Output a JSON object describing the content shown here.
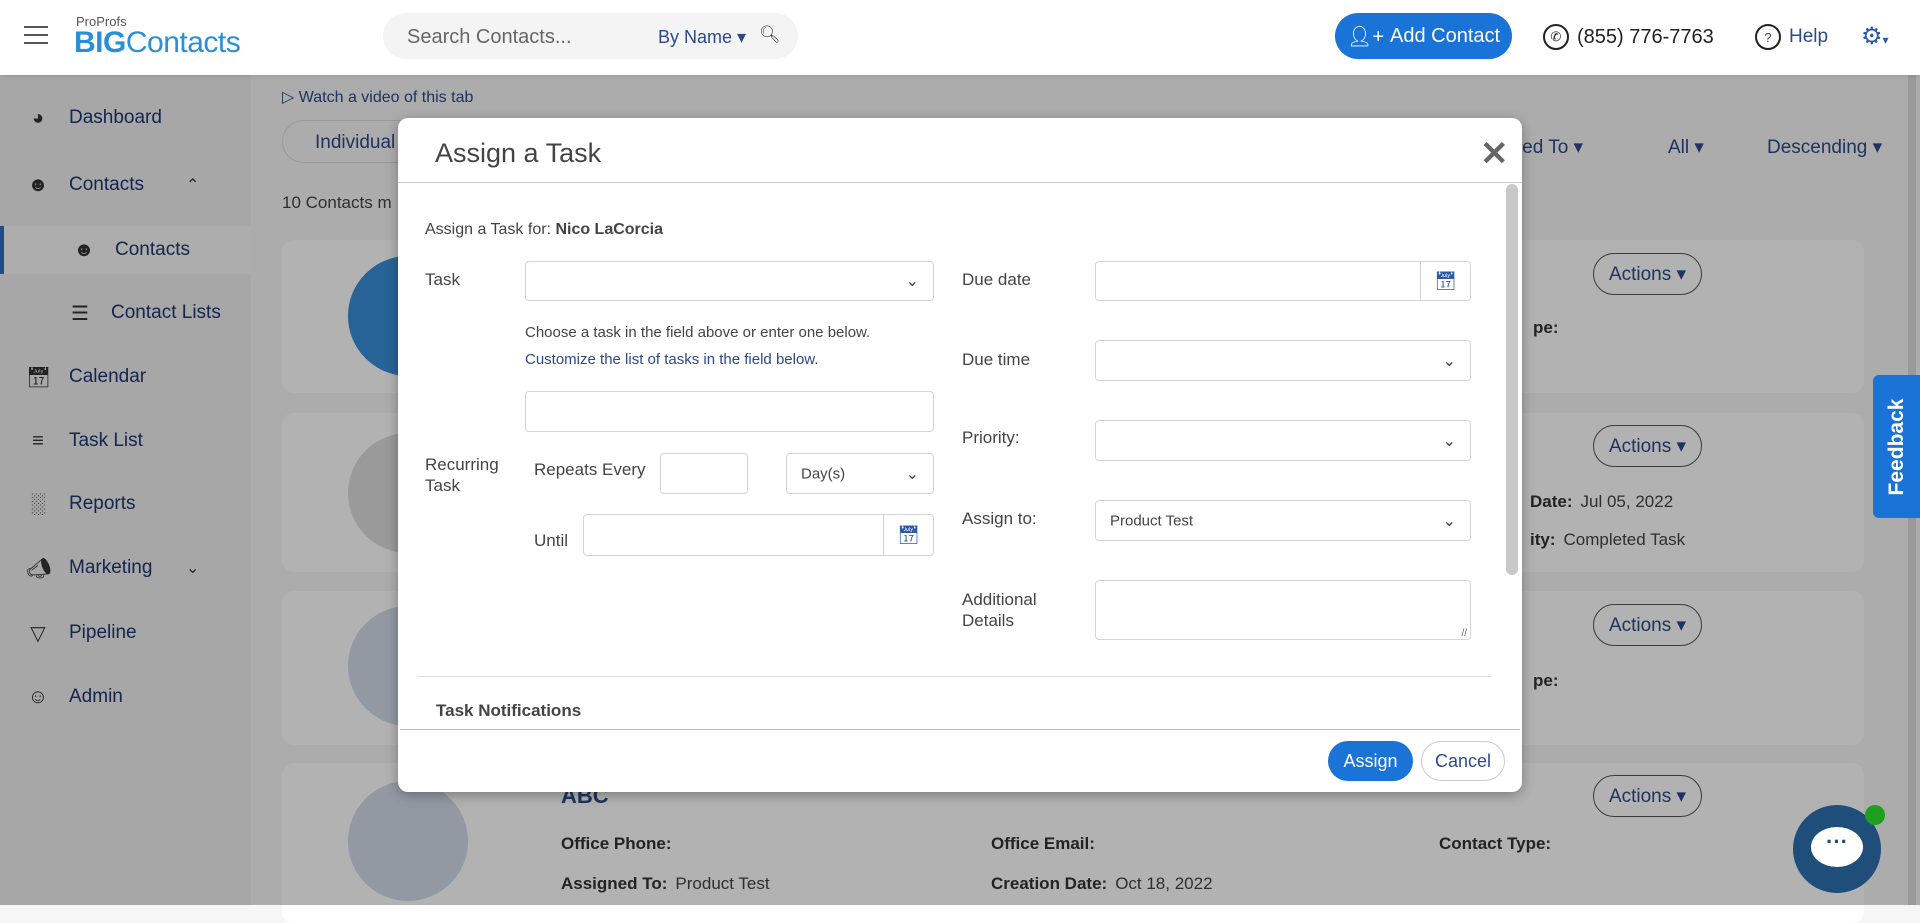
{
  "header": {
    "logo_small": "ProProfs",
    "logo_big_bold": "BIG",
    "logo_big_rest": "Contacts",
    "search_placeholder": "Search Contacts...",
    "search_by": "By Name ▾",
    "add_contact": "Add Contact",
    "phone": "(855) 776-7763",
    "help": "Help"
  },
  "sidebar": {
    "items": [
      {
        "label": "Dashboard",
        "icon": "gauge-icon"
      },
      {
        "label": "Contacts",
        "icon": "user-icon"
      },
      {
        "label": "Contacts",
        "icon": "user-icon"
      },
      {
        "label": "Contact Lists",
        "icon": "list-icon"
      },
      {
        "label": "Calendar",
        "icon": "calendar-icon"
      },
      {
        "label": "Task List",
        "icon": "checklist-icon"
      },
      {
        "label": "Reports",
        "icon": "bar-chart-icon"
      },
      {
        "label": "Marketing",
        "icon": "megaphone-icon"
      },
      {
        "label": "Pipeline",
        "icon": "filter-icon"
      },
      {
        "label": "Admin",
        "icon": "admin-icon"
      }
    ]
  },
  "main": {
    "watch_video": "Watch a video of this tab",
    "tab_individual": "Individual",
    "filters": [
      "gned To ▾",
      "All ▾",
      "Descending ▾"
    ],
    "count": "10 Contacts m",
    "actions": "Actions ▾",
    "card1": {
      "type_frag": "pe:"
    },
    "card2": {
      "date_label": "Date:",
      "date_value": "Jul 05, 2022",
      "activity_label": "ity:",
      "activity_value": "Completed Task"
    },
    "card3": {
      "type_frag": "pe:"
    },
    "card4": {
      "name": "ABC",
      "office_phone": "Office Phone:",
      "office_email": "Office Email:",
      "contact_type": "Contact Type:",
      "assigned_label": "Assigned To:",
      "assigned_value": "Product Test",
      "creation_label": "Creation Date:",
      "creation_value": "Oct 18, 2022"
    }
  },
  "feedback": "Feedback",
  "modal": {
    "title": "Assign a Task",
    "for_label": "Assign a Task for:",
    "for_name": "Nico LaCorcia",
    "task_label": "Task",
    "hint1": "Choose a task in the field above or enter one below.",
    "hint2": "Customize the list of tasks in the field below.",
    "recurring_label": "Recurring Task",
    "repeats_label": "Repeats Every",
    "repeat_unit": "Day(s)",
    "until_label": "Until",
    "due_date_label": "Due date",
    "due_time_label": "Due time",
    "priority_label": "Priority:",
    "assign_to_label": "Assign to:",
    "assign_to_value": "Product Test",
    "details_label": "Additional Details",
    "notifications": "Task Notifications",
    "assign": "Assign",
    "cancel": "Cancel"
  },
  "colors": {
    "primary": "#1a73d6",
    "nav_text": "#1d3770"
  }
}
